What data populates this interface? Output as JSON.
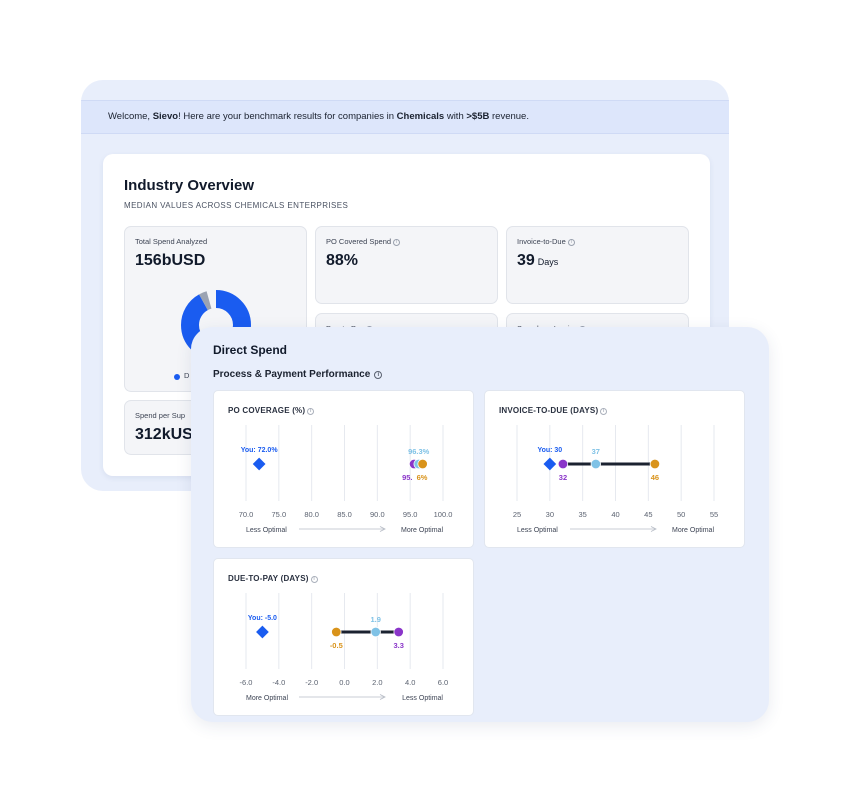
{
  "welcome": {
    "prefix": "Welcome, ",
    "user": "Sievo",
    "middle": "! Here are your benchmark results for companies in ",
    "industry": "Chemicals",
    "with": " with ",
    "revenue": ">$5B",
    "suffix": " revenue."
  },
  "overview": {
    "title": "Industry Overview",
    "subtitle": "MEDIAN VALUES ACROSS CHEMICALS ENTERPRISES",
    "cards": {
      "total_spend": {
        "label": "Total Spend Analyzed",
        "value": "156bUSD",
        "legend": "D"
      },
      "po_covered": {
        "label": "PO Covered Spend",
        "value": "88%"
      },
      "invoice_to_due": {
        "label": "Invoice-to-Due",
        "value": "39",
        "unit": "Days"
      },
      "due_to_pay": {
        "label": "Due-to-Pay"
      },
      "spend_per_invoice": {
        "label": "Spend per Invoice"
      },
      "spend_per_supplier": {
        "label": "Spend per Sup",
        "value": "312kUS"
      }
    }
  },
  "direct_spend": {
    "title": "Direct Spend",
    "section_title": "Process & Payment Performance"
  },
  "colors": {
    "you": "#1a5cf0",
    "purple": "#8a35c9",
    "light_blue": "#7fc2e6",
    "orange": "#d9931a",
    "connector": "#1b2230"
  },
  "chart_data": [
    {
      "type": "scatter",
      "title": "PO COVERAGE (%)",
      "x_ticks": [
        "70.0",
        "75.0",
        "80.0",
        "85.0",
        "90.0",
        "95.0",
        "100.0"
      ],
      "xlim": [
        70,
        100
      ],
      "direction_left": "Less Optimal",
      "direction_right": "More Optimal",
      "you_label": "You: 72.0%",
      "you": 72.0,
      "points": [
        {
          "color": "purple",
          "value": 95.6,
          "label": "95."
        },
        {
          "color": "light_blue",
          "value": 96.3,
          "label": "96.3%"
        },
        {
          "color": "orange",
          "value": 96.9,
          "label": "6%"
        }
      ],
      "overlap_label": "95.6%%"
    },
    {
      "type": "scatter",
      "title": "INVOICE-TO-DUE (DAYS)",
      "x_ticks": [
        "25",
        "30",
        "35",
        "40",
        "45",
        "50",
        "55"
      ],
      "xlim": [
        25,
        55
      ],
      "direction_left": "Less Optimal",
      "direction_right": "More Optimal",
      "you_label": "You: 30",
      "you": 30,
      "points": [
        {
          "color": "purple",
          "value": 32,
          "label": "32"
        },
        {
          "color": "light_blue",
          "value": 37,
          "label": "37"
        },
        {
          "color": "orange",
          "value": 46,
          "label": "46"
        }
      ]
    },
    {
      "type": "scatter",
      "title": "DUE-TO-PAY (DAYS)",
      "x_ticks": [
        "-6.0",
        "-4.0",
        "-2.0",
        "0.0",
        "2.0",
        "4.0",
        "6.0"
      ],
      "xlim": [
        -6,
        6
      ],
      "direction_left": "More Optimal",
      "direction_right": "Less Optimal",
      "you_label": "You: -5.0",
      "you": -5.0,
      "points": [
        {
          "color": "orange",
          "value": -0.5,
          "label": "-0.5"
        },
        {
          "color": "light_blue",
          "value": 1.9,
          "label": "1.9"
        },
        {
          "color": "purple",
          "value": 3.3,
          "label": "3.3"
        }
      ]
    }
  ]
}
